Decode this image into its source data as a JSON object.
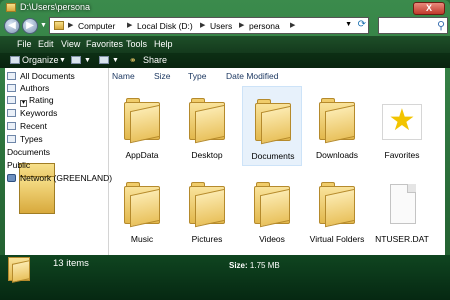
{
  "window": {
    "title": "D:\\Users\\persona",
    "close_label": "X"
  },
  "address_bar": {
    "crumbs": [
      "Computer",
      "Local Disk (D:)",
      "Users",
      "persona"
    ]
  },
  "search": {
    "placeholder": ""
  },
  "menu": [
    "File",
    "Edit",
    "View",
    "Favorites",
    "Tools",
    "Help"
  ],
  "toolbar": {
    "organize": "Organize",
    "share": "Share"
  },
  "nav_pane": {
    "items": [
      {
        "label": "All Documents",
        "icon": "search-folder-icon"
      },
      {
        "label": "Authors",
        "icon": "search-folder-icon"
      },
      {
        "label": "Rating",
        "icon": "search-folder-icon"
      },
      {
        "label": "Keywords",
        "icon": "search-folder-icon"
      },
      {
        "label": "Recent",
        "icon": "search-folder-icon"
      },
      {
        "label": "Types",
        "icon": "search-folder-icon"
      },
      {
        "label": "Documents",
        "icon": "folder-icon"
      },
      {
        "label": "Public",
        "icon": "folder-icon"
      },
      {
        "label": "Network (GREENLAND)",
        "icon": "network-icon"
      }
    ]
  },
  "columns": [
    "Name",
    "Size",
    "Type",
    "Date Modified"
  ],
  "files": [
    {
      "label": "AppData",
      "icon": "folder-icon"
    },
    {
      "label": "Desktop",
      "icon": "folder-icon"
    },
    {
      "label": "Documents",
      "icon": "documents-folder-icon"
    },
    {
      "label": "Downloads",
      "icon": "folder-icon"
    },
    {
      "label": "Favorites",
      "icon": "favorites-star-icon"
    },
    {
      "label": "Music",
      "icon": "music-folder-icon"
    },
    {
      "label": "Pictures",
      "icon": "pictures-folder-icon"
    },
    {
      "label": "Videos",
      "icon": "videos-folder-icon"
    },
    {
      "label": "Virtual Folders",
      "icon": "folder-icon"
    },
    {
      "label": "NTUSER.DAT",
      "icon": "file-icon"
    }
  ],
  "status": {
    "item_count": "13 items",
    "size_label": "Size:",
    "size_value": "1.75 MB"
  },
  "colors": {
    "frame": "#2f7a3f",
    "toolbar": "#0a2410",
    "statusbar": "#0f4520",
    "folder": "#e9c25e"
  }
}
